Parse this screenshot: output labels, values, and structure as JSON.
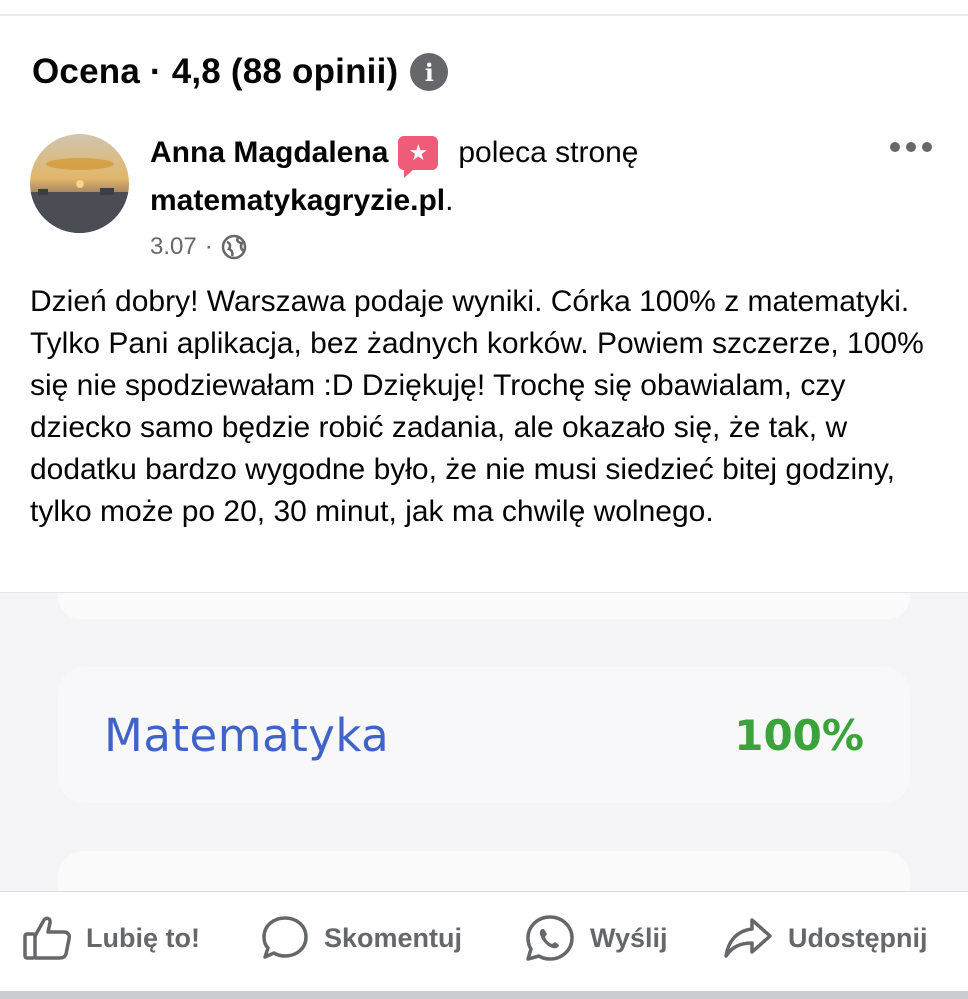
{
  "header": {
    "rating_title": "Ocena · 4,8 (88 opinii)",
    "info_icon": "info-icon"
  },
  "post": {
    "author": "Anna Magdalena",
    "recommend_badge_icon": "recommend-star-icon",
    "recommend_text": "poleca stronę",
    "page_name": "matematykagryzie.pl",
    "page_name_suffix": ".",
    "date": "3.07",
    "separator": "·",
    "audience_icon": "globe-icon",
    "body": "Dzień dobry! Warszawa podaje wyniki. Córka 100% z matematyki. Tylko Pani aplikacja, bez żadnych korków. Powiem szczerze, 100% się nie spodziewałam :D Dziękuję! Trochę się obawialam, czy dziecko samo będzie robić zadania, ale okazało się, że tak, w dodatku bardzo wygodne było, że nie musi siedzieć bitej godziny, tylko może po 20, 30 minut, jak ma chwilę wolnego."
  },
  "image": {
    "subject": "Matematyka",
    "score": "100%"
  },
  "actions": {
    "like": "Lubię to!",
    "comment": "Skomentuj",
    "send": "Wyślij",
    "share": "Udostępnij"
  },
  "colors": {
    "subject_blue": "#3f63c7",
    "score_green": "#3aa33a",
    "badge_pink": "#f05b7a",
    "muted_gray": "#65676b"
  }
}
